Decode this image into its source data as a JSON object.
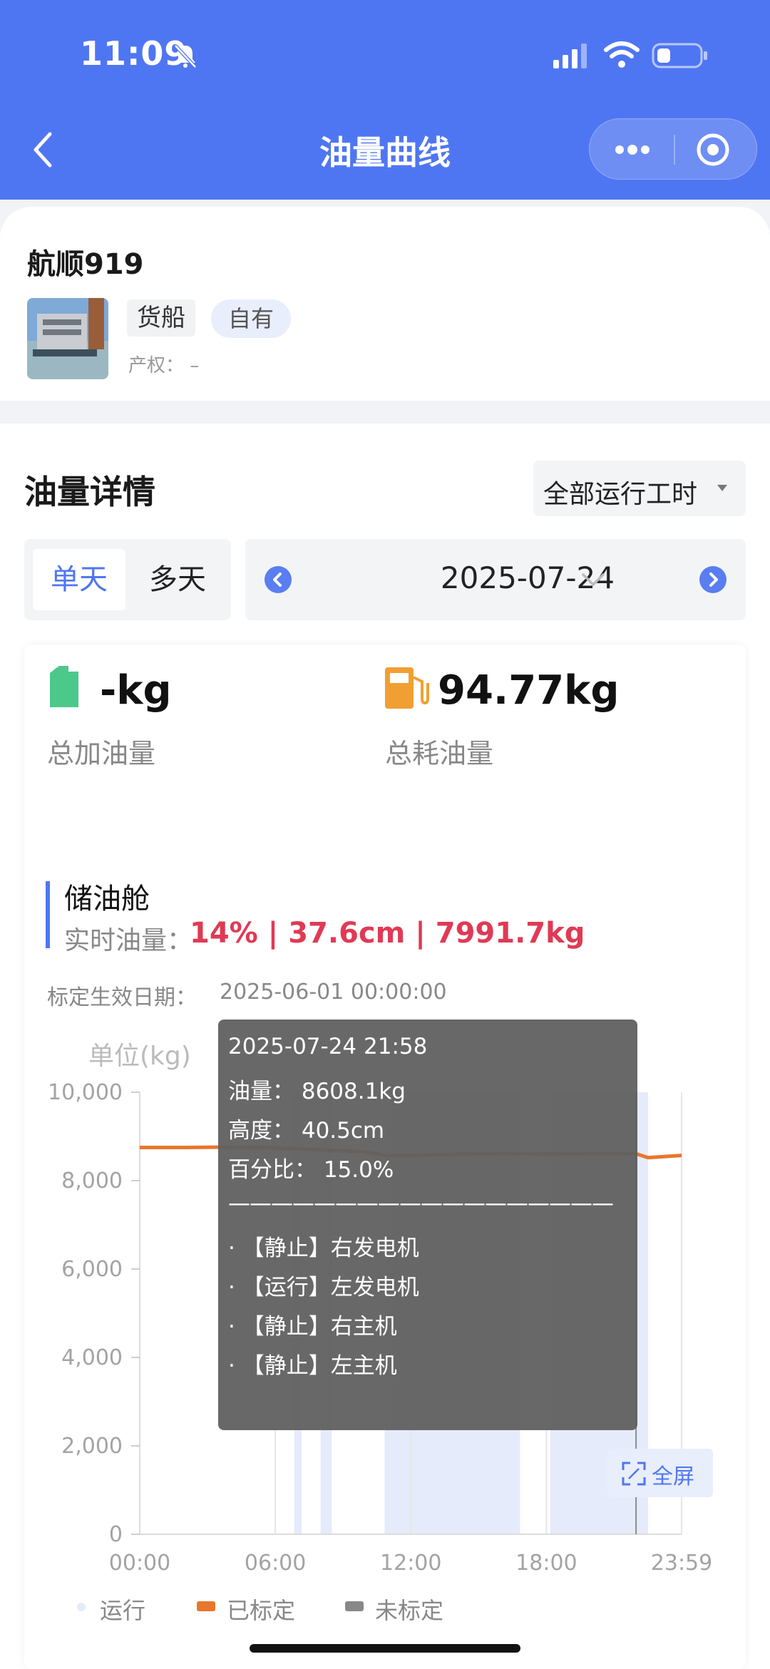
{
  "status_bar": {
    "time": "11:09"
  },
  "nav": {
    "title": "油量曲线"
  },
  "ship": {
    "name": "航顺919",
    "type_tag": "货船",
    "owner_tag": "自有",
    "ownership_label": "产权：",
    "ownership_value": "–"
  },
  "oil": {
    "section_title": "油量详情",
    "filter_label": "全部运行工时",
    "tabs": [
      "单天",
      "多天"
    ],
    "date": "2025-07-24",
    "stats": [
      {
        "value": "-kg",
        "label": "总加油量"
      },
      {
        "value": "94.77kg",
        "label": "总耗油量"
      }
    ],
    "tank": {
      "name": "储油舱",
      "realtime_label": "实时油量：",
      "realtime_value": "14% | 37.6cm | 7991.7kg",
      "calib_label": "标定生效日期：",
      "calib_value": "2025-06-01 00:00:00"
    }
  },
  "chart_data": {
    "type": "line",
    "ylabel": "单位(kg)",
    "ylim": [
      0,
      10000
    ],
    "yticks": [
      "10,000",
      "8,000",
      "6,000",
      "4,000",
      "2,000",
      "0"
    ],
    "xticks": [
      "00:00",
      "06:00",
      "12:00",
      "18:00",
      "23:59"
    ],
    "series": [
      {
        "name": "已标定",
        "color": "#e8762d",
        "x": [
          "00:00",
          "02:00",
          "04:00",
          "06:00",
          "08:00",
          "10:00",
          "11:00",
          "12:00",
          "14:00",
          "16:00",
          "18:00",
          "20:00",
          "21:58",
          "22:30",
          "23:59"
        ],
        "values": [
          8750,
          8750,
          8760,
          8740,
          8700,
          8650,
          8560,
          8570,
          8600,
          8610,
          8600,
          8610,
          8608,
          8520,
          8570
        ]
      }
    ],
    "running_intervals": [
      [
        "06:50",
        "07:10"
      ],
      [
        "08:00",
        "08:30"
      ],
      [
        "10:50",
        "16:50"
      ],
      [
        "18:10",
        "22:30"
      ]
    ],
    "legend": [
      {
        "label": "运行",
        "color": "#e6ebfb"
      },
      {
        "label": "已标定",
        "color": "#e8762d"
      },
      {
        "label": "未标定",
        "color": "#888888"
      }
    ],
    "tooltip": {
      "time": "2025-07-24 21:58",
      "oil": "油量：  8608.1kg",
      "height": "高度：  40.5cm",
      "percent": "百分比：  15.0%",
      "divider": "——————————————————",
      "items": [
        "·  【静止】右发电机",
        "·  【运行】左发电机",
        "·  【静止】右主机",
        "·  【静止】左主机"
      ]
    },
    "fullscreen_label": "全屏"
  }
}
